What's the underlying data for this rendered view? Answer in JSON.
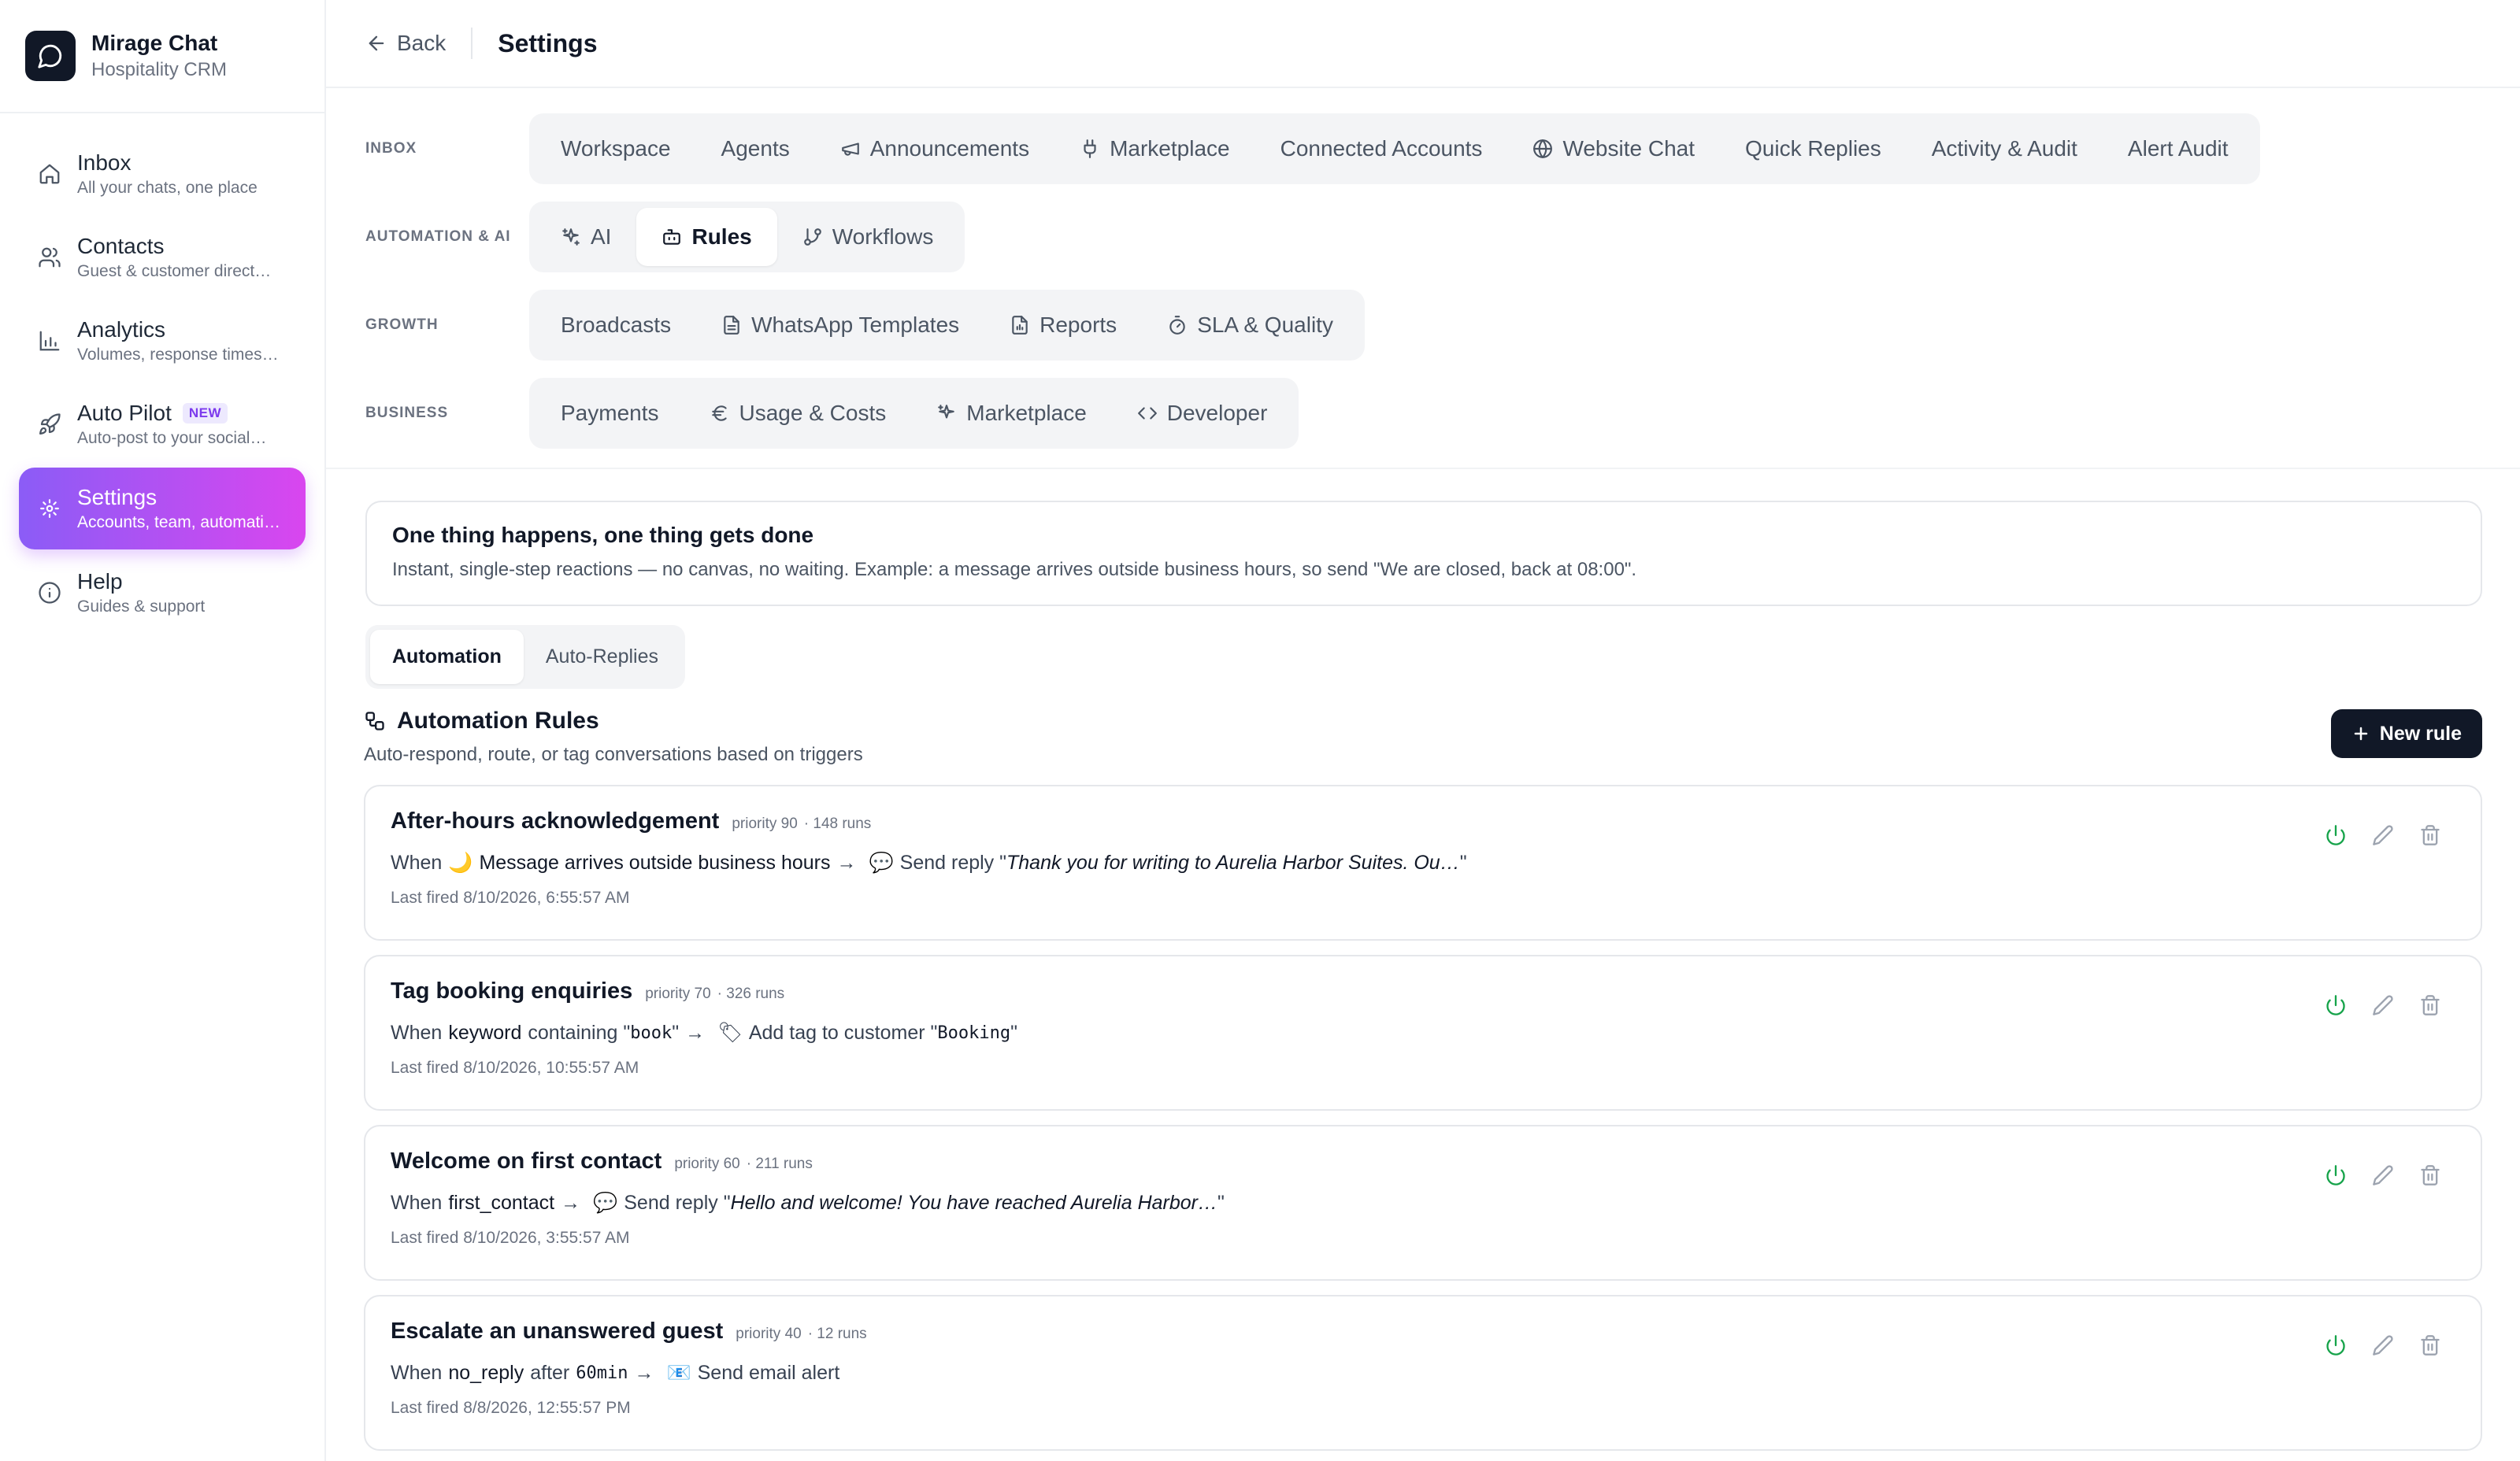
{
  "brand": {
    "name": "Mirage Chat",
    "subtitle": "Hospitality CRM"
  },
  "sidebar": {
    "items": [
      {
        "title": "Inbox",
        "subtitle": "All your chats, one place",
        "icon": "home-icon"
      },
      {
        "title": "Contacts",
        "subtitle": "Guest & customer direct…",
        "icon": "users-icon"
      },
      {
        "title": "Analytics",
        "subtitle": "Volumes, response times…",
        "icon": "bar-chart-icon"
      },
      {
        "title": "Auto Pilot",
        "badge": "NEW",
        "subtitle": "Auto-post to your social…",
        "icon": "rocket-icon"
      },
      {
        "title": "Settings",
        "subtitle": "Accounts, team, automati…",
        "icon": "gear-icon",
        "active": true
      },
      {
        "title": "Help",
        "subtitle": "Guides & support",
        "icon": "info-icon"
      }
    ]
  },
  "topbar": {
    "back_label": "Back",
    "title": "Settings"
  },
  "settings_nav": {
    "inbox": {
      "label": "INBOX",
      "tabs": [
        "Workspace",
        "Agents",
        "Announcements",
        "Marketplace",
        "Connected Accounts",
        "Website Chat",
        "Quick Replies",
        "Activity & Audit",
        "Alert Audit"
      ]
    },
    "automation": {
      "label": "AUTOMATION & AI",
      "tabs": [
        "AI",
        "Rules",
        "Workflows"
      ],
      "active": "Rules"
    },
    "growth": {
      "label": "GROWTH",
      "tabs": [
        "Broadcasts",
        "WhatsApp Templates",
        "Reports",
        "SLA & Quality"
      ]
    },
    "business": {
      "label": "BUSINESS",
      "tabs": [
        "Payments",
        "Usage & Costs",
        "Marketplace",
        "Developer"
      ]
    }
  },
  "info": {
    "title": "One thing happens, one thing gets done",
    "description": "Instant, single-step reactions — no canvas, no waiting. Example: a message arrives outside business hours, so send \"We are closed, back at 08:00\"."
  },
  "subtabs": {
    "automation": "Automation",
    "auto_replies": "Auto-Replies"
  },
  "rules_section": {
    "title": "Automation Rules",
    "subtitle": "Auto-respond, route, or tag conversations based on triggers",
    "new_rule_label": "New rule"
  },
  "rules": [
    {
      "name": "After-hours acknowledgement",
      "priority": "priority 90",
      "runs": "· 148 runs",
      "when": "When",
      "trigger_emoji": "🌙",
      "trigger": "Message arrives outside business hours",
      "arrow": "→",
      "action_emoji": "💬",
      "action": "Send reply \"",
      "action_value": "Thank you for writing to Aurelia Harbor Suites. Ou…",
      "action_end": "\"",
      "last_fired": "Last fired 8/10/2026, 6:55:57 AM"
    },
    {
      "name": "Tag booking enquiries",
      "priority": "priority 70",
      "runs": "· 326 runs",
      "when": "When",
      "trigger_key": "keyword",
      "trigger_mid": "containing \"",
      "trigger_code": "book",
      "trigger_end": "\"",
      "arrow": "→",
      "action_emoji": "🏷",
      "action": "Add tag to customer \"",
      "action_code": "Booking",
      "action_end": "\"",
      "last_fired": "Last fired 8/10/2026, 10:55:57 AM"
    },
    {
      "name": "Welcome on first contact",
      "priority": "priority 60",
      "runs": "· 211 runs",
      "when": "When",
      "trigger_key": "first_contact",
      "arrow": "→",
      "action_emoji": "💬",
      "action": "Send reply \"",
      "action_value": "Hello and welcome! You have reached Aurelia Harbor…",
      "action_end": "\"",
      "last_fired": "Last fired 8/10/2026, 3:55:57 AM"
    },
    {
      "name": "Escalate an unanswered guest",
      "priority": "priority 40",
      "runs": "· 12 runs",
      "when": "When",
      "trigger_key": "no_reply",
      "trigger_mid": "after",
      "trigger_code": "60min",
      "arrow": "→",
      "action_emoji": "📧",
      "action": "Send email alert",
      "last_fired": "Last fired 8/8/2026, 12:55:57 PM"
    }
  ],
  "colors": {
    "accent_start": "#8b5cf6",
    "accent_end": "#d946ef",
    "power_green": "#16a34a",
    "dark": "#111827"
  }
}
